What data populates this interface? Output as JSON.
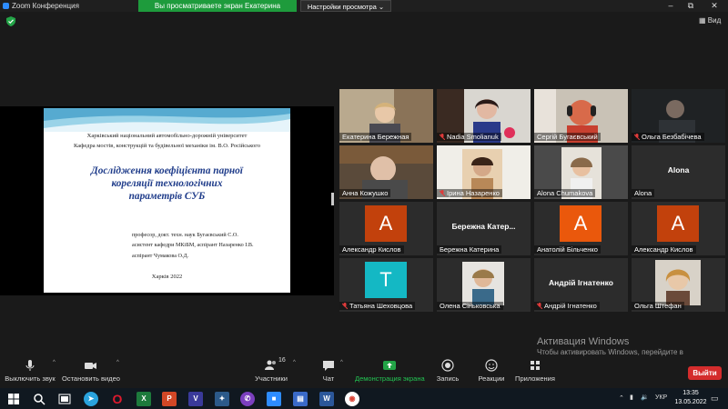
{
  "window": {
    "title": "Zoom Конференция",
    "share_banner": "Вы просматриваете экран Екатерина Бережная",
    "view_settings": "Настройки просмотра",
    "view_button": "Вид"
  },
  "slide": {
    "university": "Харківський національний автомобільно-дорожній університет",
    "department": "Кафедра мостів, конструкцій та будівельної механіки ім. В.О. Російського",
    "title_line1": "Дослідження коефіцієнта парної",
    "title_line2": "кореляції технологічних",
    "title_line3": "параметрів СУБ",
    "author1": "професор, докт. техн. наук Бугаєвський С.О.",
    "author2": "асистент кафедри МКіБМ, аспірант Назаренко І.В.",
    "author3": "аспірант Чумакова О.Д.",
    "city_year": "Харків 2022"
  },
  "participants": [
    {
      "name": "Екатерина Бережная",
      "type": "video",
      "muted": false
    },
    {
      "name": "Nadia Smolianuk",
      "type": "video",
      "muted": true
    },
    {
      "name": "Сергій Бугаєвський",
      "type": "video",
      "muted": false,
      "active": true
    },
    {
      "name": "Ольга Безбабічева",
      "type": "video",
      "muted": true
    },
    {
      "name": "Анна Кожушко",
      "type": "video",
      "muted": false
    },
    {
      "name": "Ірина Назаренко",
      "type": "video",
      "muted": true
    },
    {
      "name": "Alona Chumakova",
      "type": "video",
      "muted": false
    },
    {
      "name": "Alona",
      "type": "name",
      "label": "Alona",
      "muted": false
    },
    {
      "name": "Александр Кислов",
      "type": "avatar",
      "letter": "A",
      "color": "#c2410c",
      "muted": false
    },
    {
      "name": "Бережна Катерина",
      "type": "name",
      "label": "Бережна Катер...",
      "muted": false
    },
    {
      "name": "Анатолій Більченко",
      "type": "avatar",
      "letter": "A",
      "color": "#ea580c",
      "muted": false
    },
    {
      "name": "Александр Кислов",
      "type": "avatar",
      "letter": "A",
      "color": "#c2410c",
      "muted": false
    },
    {
      "name": "Татьяна Шеховцова",
      "type": "avatar",
      "letter": "T",
      "color": "#14b8c4",
      "muted": true
    },
    {
      "name": "Олена Сіньковська",
      "type": "video",
      "muted": false
    },
    {
      "name": "Андрій Ігнатенко",
      "type": "name",
      "label": "Андрій Ігнатенко",
      "muted": true
    },
    {
      "name": "Ольга Штефан",
      "type": "video",
      "muted": false
    }
  ],
  "toolbar": {
    "mute": "Выключить звук",
    "video": "Остановить видео",
    "participants": "Участники",
    "participants_count": "16",
    "chat": "Чат",
    "share": "Демонстрация экрана",
    "record": "Запись",
    "reactions": "Реакции",
    "apps": "Приложения",
    "leave": "Выйти"
  },
  "activation": {
    "title": "Активация Windows",
    "subtitle": "Чтобы активировать Windows, перейдите в раздел \"Параметры\"."
  },
  "taskbar": {
    "lang": "УКР",
    "time": "13:35",
    "date": "13.05.2022"
  },
  "colors": {
    "share_green": "#1e9b3c",
    "leave_red": "#d42c2c",
    "active_outline": "#c8d830",
    "slide_title_blue": "#1f3c8a"
  }
}
